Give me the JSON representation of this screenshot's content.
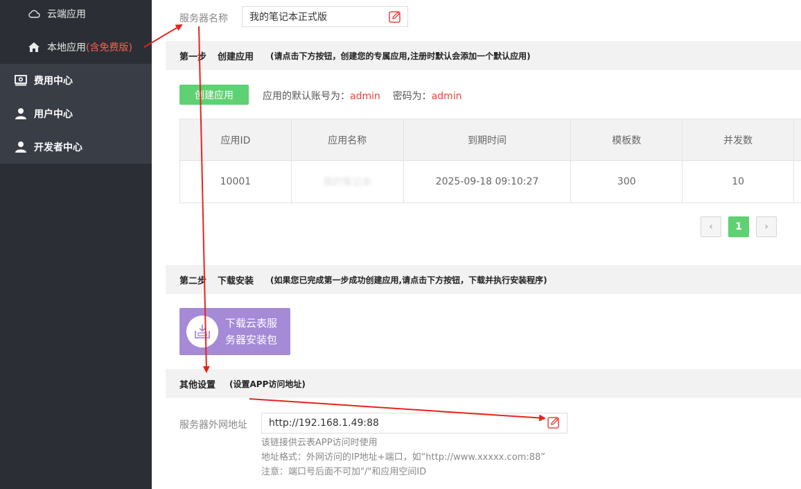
{
  "sidebar": {
    "cloud_app": "云端应用",
    "local_app": "本地应用",
    "local_app_tag": "(含免费版)",
    "billing": "费用中心",
    "user_center": "用户中心",
    "developer_center": "开发者中心"
  },
  "server_name": {
    "label": "服务器名称",
    "value": "我的笔记本正式版"
  },
  "step1": {
    "step": "第一步",
    "name": "创建应用",
    "hint": "(请点击下方按钮，创建您的专属应用,注册时默认会添加一个默认应用)",
    "button": "创建应用",
    "account_prefix": "应用的默认账号为：",
    "account": "admin",
    "password_prefix": "密码为：",
    "password": "admin"
  },
  "table": {
    "headers": [
      "应用ID",
      "应用名称",
      "到期时间",
      "模板数",
      "并发数"
    ],
    "rows": [
      {
        "id": "10001",
        "name": "我的笔记本",
        "expire": "2025-09-18 09:10:27",
        "templates": "300",
        "concurrency": "10"
      }
    ]
  },
  "pagination": {
    "prev": "‹",
    "current": "1",
    "next": "›"
  },
  "step2": {
    "step": "第二步",
    "name": "下载安装",
    "hint": "(如果您已完成第一步成功创建应用,请点击下方按钮，下载并执行安装程序)",
    "download_line1": "下载云表服",
    "download_line2": "务器安装包"
  },
  "other": {
    "name": "其他设置",
    "hint": "(设置APP访问地址)",
    "ext_label": "服务器外网地址",
    "ext_value": "http://192.168.1.49:88",
    "help1": "该链接供云表APP访问时使用",
    "help2": "地址格式：外网访问的IP地址+端口，如“http://www.xxxxx.com:88”",
    "help3": "注意：端口号后面不可加\"/\"和应用空间ID"
  },
  "colors": {
    "sidebar_bg": "#2b2f35",
    "accent_green": "#5fd173",
    "accent_red": "#e9453b",
    "download_purple": "#a58ad7"
  }
}
